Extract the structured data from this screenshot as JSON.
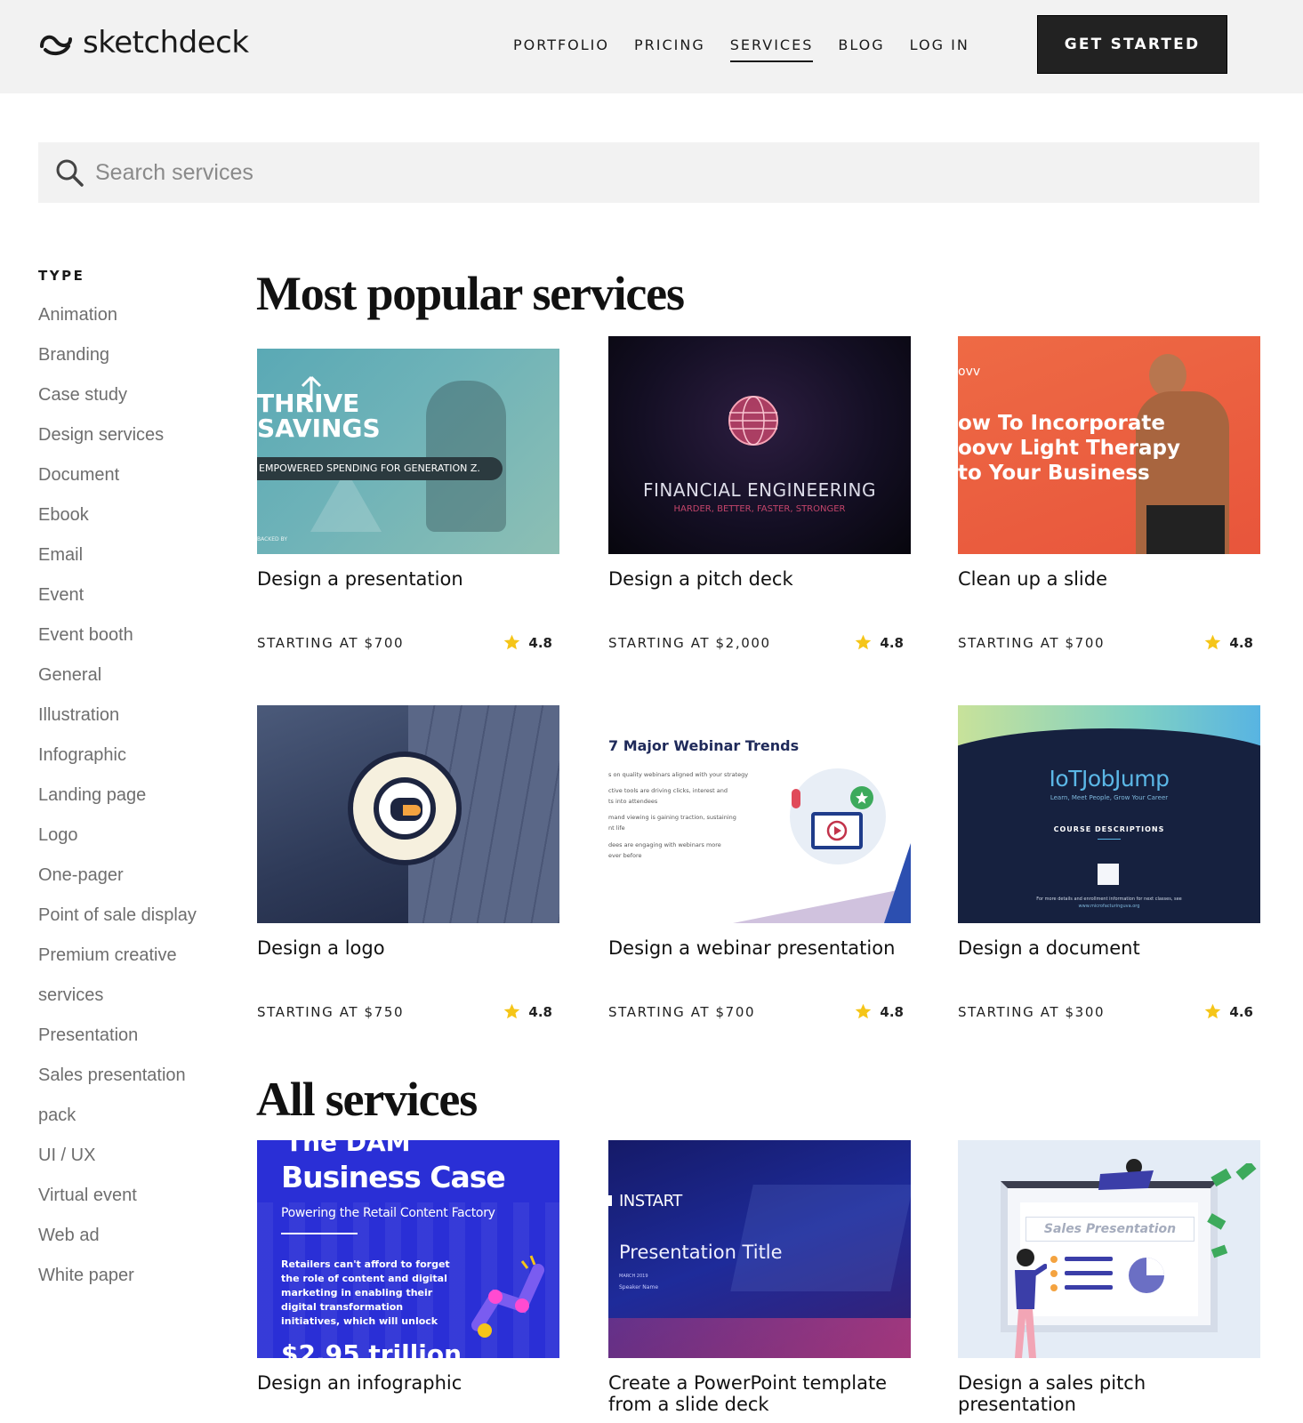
{
  "brand": {
    "name": "sketchdeck"
  },
  "nav": {
    "items": [
      {
        "label": "PORTFOLIO",
        "active": false
      },
      {
        "label": "PRICING",
        "active": false
      },
      {
        "label": "SERVICES",
        "active": true
      },
      {
        "label": "BLOG",
        "active": false
      },
      {
        "label": "LOG IN",
        "active": false
      }
    ],
    "cta_label": "GET STARTED"
  },
  "search": {
    "placeholder": "Search services",
    "value": ""
  },
  "sidebar": {
    "heading": "TYPE",
    "items": [
      "Animation",
      "Branding",
      "Case study",
      "Design services",
      "Document",
      "Ebook",
      "Email",
      "Event",
      "Event booth",
      "General",
      "Illustration",
      "Infographic",
      "Landing page",
      "Logo",
      "One-pager",
      "Point of sale display",
      "Premium creative",
      "services",
      "Presentation",
      "Sales presentation",
      "pack",
      "UI / UX",
      "Virtual event",
      "Web ad",
      "White paper"
    ]
  },
  "popular": {
    "title": "Most popular services",
    "cards": [
      {
        "title": "Design a presentation",
        "price": "STARTING AT $700",
        "rating": "4.8",
        "thumb": {
          "line1": "THRIVE",
          "line2": "SAVINGS",
          "tagline": "EMPOWERED SPENDING FOR GENERATION Z.",
          "footnote": "BACKED BY"
        }
      },
      {
        "title": "Design a pitch deck",
        "price": "STARTING AT $2,000",
        "rating": "4.8",
        "thumb": {
          "headline": "FINANCIAL ENGINEERING",
          "subline": "HARDER, BETTER, FASTER, STRONGER"
        }
      },
      {
        "title": "Clean up a slide",
        "price": "STARTING AT $700",
        "rating": "4.8",
        "thumb": {
          "brand": "ovv",
          "line1": "ow To Incorporate",
          "line2": "oovv Light Therapy",
          "line3": "to Your Business"
        }
      },
      {
        "title": "Design a logo",
        "price": "STARTING AT $750",
        "rating": "4.8",
        "thumb": {}
      },
      {
        "title": "Design a webinar presentation",
        "price": "STARTING AT $700",
        "rating": "4.8",
        "thumb": {
          "headline": "7 Major Webinar Trends",
          "bullets": [
            "s on quality webinars aligned with your strategy",
            "ctive tools are driving clicks, interest and",
            "ts into attendees",
            "mand viewing is gaining traction, sustaining",
            "nt life",
            "dees are engaging with webinars more",
            "ever before"
          ]
        }
      },
      {
        "title": "Design a document",
        "price": "STARTING AT $300",
        "rating": "4.6",
        "thumb": {
          "logo": "IoTJobJump",
          "tagline": "Learn, Meet People, Grow Your Career",
          "heading": "COURSE DESCRIPTIONS",
          "footnote": "For more details and enrollment information for next classes, see",
          "url": "www.microfacturinguva.org"
        }
      }
    ]
  },
  "all": {
    "title": "All services",
    "cards": [
      {
        "title": "Design an infographic",
        "thumb": {
          "top": "The DAM",
          "headline": "Business Case",
          "subline": "Powering the Retail Content Factory",
          "body": [
            "Retailers can't afford to forget",
            "the role of content and digital",
            "marketing in enabling their",
            "digital transformation",
            "initiatives, which will unlock"
          ],
          "bottom": "$2.95 trillion"
        }
      },
      {
        "title": "Create a PowerPoint template from a slide deck",
        "thumb": {
          "brand": "INSTART",
          "headline": "Presentation Title",
          "date": "MARCH 2019",
          "speaker": "Speaker Name"
        }
      },
      {
        "title": "Design a sales pitch presentation",
        "thumb": {
          "label": "Sales Presentation"
        }
      }
    ]
  },
  "colors": {
    "star": "#f5c518",
    "cta_bg": "#222222",
    "header_bg": "#f2f2f2"
  }
}
